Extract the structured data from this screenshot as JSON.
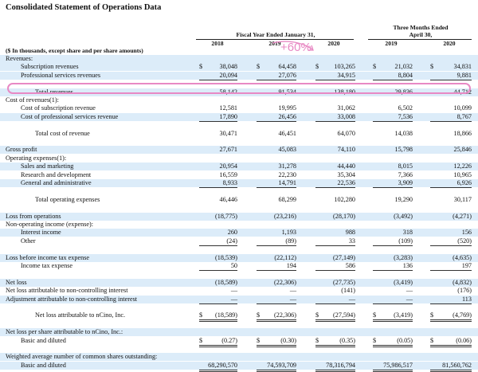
{
  "title": "Consolidated Statement of Operations Data",
  "header": {
    "fiscal_group": "Fiscal Year Ended January 31,",
    "three_months_line1": "Three Months Ended",
    "three_months_line2": "April 30,",
    "years": [
      "2018",
      "2019",
      "2020",
      "2019",
      "2020"
    ],
    "units_note": "($ In thousands, except share and per share amounts)"
  },
  "annotation": {
    "text": "+60%",
    "color": "#e889c4"
  },
  "rows": [
    {
      "label": "Revenues:",
      "indent": 0,
      "shade": true
    },
    {
      "label": "Subscription revenues",
      "indent": 1,
      "shade": true,
      "dollar": true,
      "values": [
        "38,048",
        "64,458",
        "103,265",
        "21,032",
        "34,831"
      ]
    },
    {
      "label": "Professional services revenues",
      "indent": 1,
      "shade": true,
      "values": [
        "20,094",
        "27,076",
        "34,915",
        "8,804",
        "9,881"
      ],
      "underline": true
    },
    {
      "label": "",
      "indent": 0
    },
    {
      "label": "Total revenues",
      "indent": 2,
      "shade": true,
      "values": [
        "58,142",
        "91,534",
        "138,180",
        "29,836",
        "44,712"
      ]
    },
    {
      "label": "Cost of revenues(1):",
      "indent": 0
    },
    {
      "label": "Cost of subscription revenue",
      "indent": 1,
      "values": [
        "12,581",
        "19,995",
        "31,062",
        "6,502",
        "10,099"
      ]
    },
    {
      "label": "Cost of professional services revenue",
      "indent": 1,
      "shade": true,
      "values": [
        "17,890",
        "26,456",
        "33,008",
        "7,536",
        "8,767"
      ],
      "underline": true
    },
    {
      "label": "",
      "indent": 0
    },
    {
      "label": "Total cost of revenue",
      "indent": 2,
      "values": [
        "30,471",
        "46,451",
        "64,070",
        "14,038",
        "18,866"
      ]
    },
    {
      "label": "",
      "indent": 0
    },
    {
      "label": "Gross profit",
      "indent": 0,
      "shade": true,
      "values": [
        "27,671",
        "45,083",
        "74,110",
        "15,798",
        "25,846"
      ]
    },
    {
      "label": "Operating expenses(1):",
      "indent": 0
    },
    {
      "label": "Sales and marketing",
      "indent": 1,
      "shade": true,
      "values": [
        "20,954",
        "31,278",
        "44,440",
        "8,015",
        "12,226"
      ]
    },
    {
      "label": "Research and development",
      "indent": 1,
      "values": [
        "16,559",
        "22,230",
        "35,304",
        "7,366",
        "10,965"
      ]
    },
    {
      "label": "General and administrative",
      "indent": 1,
      "shade": true,
      "values": [
        "8,933",
        "14,791",
        "22,536",
        "3,909",
        "6,926"
      ],
      "underline": true
    },
    {
      "label": "",
      "indent": 0
    },
    {
      "label": "Total operating expenses",
      "indent": 2,
      "values": [
        "46,446",
        "68,299",
        "102,280",
        "19,290",
        "30,117"
      ]
    },
    {
      "label": "",
      "indent": 0
    },
    {
      "label": "Loss from operations",
      "indent": 0,
      "shade": true,
      "values": [
        "(18,775)",
        "(23,216)",
        "(28,170)",
        "(3,492)",
        "(4,271)"
      ]
    },
    {
      "label": "Non-operating income (expense):",
      "indent": 0
    },
    {
      "label": "Interest income",
      "indent": 1,
      "shade": true,
      "values": [
        "260",
        "1,193",
        "988",
        "318",
        "156"
      ]
    },
    {
      "label": "Other",
      "indent": 1,
      "values": [
        "(24)",
        "(89)",
        "33",
        "(109)",
        "(520)"
      ],
      "underline": true
    },
    {
      "label": "",
      "indent": 0
    },
    {
      "label": "Loss before income tax expense",
      "indent": 0,
      "shade": true,
      "values": [
        "(18,539)",
        "(22,112)",
        "(27,149)",
        "(3,283)",
        "(4,635)"
      ]
    },
    {
      "label": "Income tax expense",
      "indent": 1,
      "values": [
        "50",
        "194",
        "586",
        "136",
        "197"
      ],
      "underline": true
    },
    {
      "label": "",
      "indent": 0
    },
    {
      "label": "Net loss",
      "indent": 0,
      "shade": true,
      "values": [
        "(18,589)",
        "(22,306)",
        "(27,735)",
        "(3,419)",
        "(4,832)"
      ]
    },
    {
      "label": "Net loss attributable to non-controlling interest",
      "indent": 0,
      "values": [
        "—",
        "—",
        "(141)",
        "—",
        "(176)"
      ]
    },
    {
      "label": "Adjustment attributable to non-controlling interest",
      "indent": 0,
      "shade": true,
      "values": [
        "—",
        "—",
        "—",
        "—",
        "113"
      ],
      "underline": true
    },
    {
      "label": "",
      "indent": 0
    },
    {
      "label": "Net loss attributable to nCino, Inc.",
      "indent": 2,
      "dollar": true,
      "values": [
        "(18,589)",
        "(22,306)",
        "(27,594)",
        "(3,419)",
        "(4,769)"
      ],
      "dunderline": true
    },
    {
      "label": "",
      "indent": 0
    },
    {
      "label": "Net loss per share attributable to nCino, Inc.:",
      "indent": 0,
      "shade": true
    },
    {
      "label": "Basic and diluted",
      "indent": 1,
      "dollar": true,
      "values": [
        "(0.27)",
        "(0.30)",
        "(0.35)",
        "(0.05)",
        "(0.06)"
      ],
      "dunderline": true
    },
    {
      "label": "",
      "indent": 0
    },
    {
      "label": "Weighted average number of common shares outstanding:",
      "indent": 0,
      "shade": true
    },
    {
      "label": "Basic and diluted",
      "indent": 1,
      "shade": true,
      "values": [
        "68,290,570",
        "74,593,709",
        "78,316,794",
        "75,986,517",
        "81,560,762"
      ],
      "dunderline": true
    }
  ]
}
